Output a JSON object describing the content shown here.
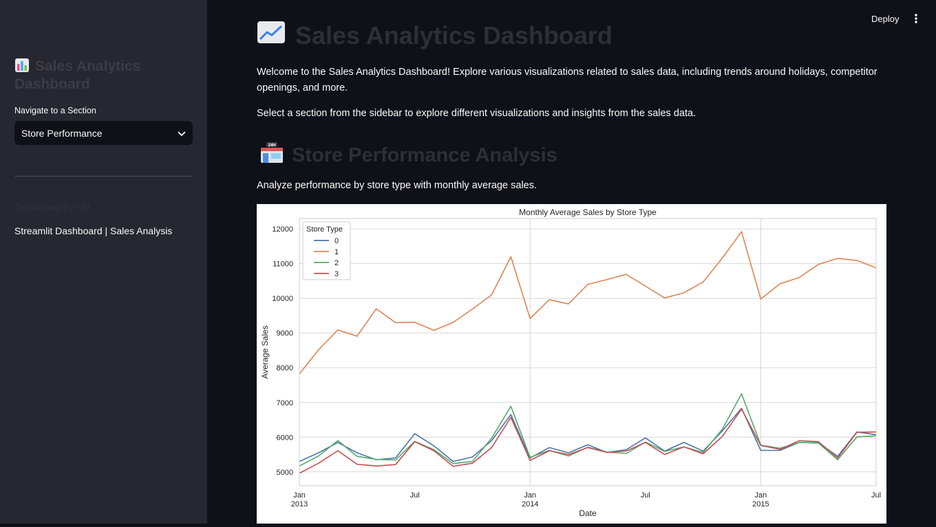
{
  "sidebar": {
    "title": "Sales Analytics Dashboard",
    "nav_label": "Navigate to a Section",
    "selected_section": "Store Performance",
    "developer_text": "Developed by KM",
    "footer_text": "Streamlit Dashboard | Sales Analysis"
  },
  "header": {
    "deploy_label": "Deploy"
  },
  "main": {
    "title": "Sales Analytics Dashboard",
    "welcome": "Welcome to the Sales Analytics Dashboard! Explore various visualizations related to sales data, including trends around holidays, competitor openings, and more.",
    "instruction": "Select a section from the sidebar to explore different visualizations and insights from the sales data.",
    "section_title": "Store Performance Analysis",
    "section_desc": "Analyze performance by store type with monthly average sales."
  },
  "chart_data": {
    "type": "line",
    "title": "Monthly Average Sales by Store Type",
    "xlabel": "Date",
    "ylabel": "Average Sales",
    "legend_title": "Store Type",
    "legend_position": "top-left",
    "grid": true,
    "ylim": [
      4600,
      12300
    ],
    "yticks": [
      5000,
      6000,
      7000,
      8000,
      9000,
      10000,
      11000,
      12000
    ],
    "xticks": [
      {
        "index": 0,
        "label": "Jan",
        "sub": "2013"
      },
      {
        "index": 6,
        "label": "Jul",
        "sub": ""
      },
      {
        "index": 12,
        "label": "Jan",
        "sub": "2014"
      },
      {
        "index": 18,
        "label": "Jul",
        "sub": ""
      },
      {
        "index": 24,
        "label": "Jan",
        "sub": "2015"
      },
      {
        "index": 30,
        "label": "Jul",
        "sub": ""
      }
    ],
    "major_grid_indices": [
      12,
      24
    ],
    "x": [
      "2013-01",
      "2013-02",
      "2013-03",
      "2013-04",
      "2013-05",
      "2013-06",
      "2013-07",
      "2013-08",
      "2013-09",
      "2013-10",
      "2013-11",
      "2013-12",
      "2014-01",
      "2014-02",
      "2014-03",
      "2014-04",
      "2014-05",
      "2014-06",
      "2014-07",
      "2014-08",
      "2014-09",
      "2014-10",
      "2014-11",
      "2014-12",
      "2015-01",
      "2015-02",
      "2015-03",
      "2015-04",
      "2015-05",
      "2015-06",
      "2015-07"
    ],
    "series": [
      {
        "name": "0",
        "color": "#4c72b0",
        "values": [
          5300,
          5550,
          5850,
          5550,
          5350,
          5400,
          6100,
          5750,
          5300,
          5430,
          5900,
          6650,
          5400,
          5700,
          5550,
          5780,
          5560,
          5640,
          5980,
          5600,
          5850,
          5600,
          6180,
          6830,
          5620,
          5620,
          5850,
          5840,
          5450,
          6150,
          6070
        ]
      },
      {
        "name": "1",
        "color": "#dd8452",
        "values": [
          7820,
          8520,
          9090,
          8910,
          9700,
          9300,
          9310,
          9080,
          9310,
          9690,
          10100,
          11200,
          9420,
          9960,
          9840,
          10400,
          10540,
          10690,
          10350,
          10010,
          10160,
          10470,
          11160,
          11920,
          9980,
          10420,
          10600,
          10980,
          11150,
          11090,
          10880
        ]
      },
      {
        "name": "2",
        "color": "#55a868",
        "values": [
          5170,
          5460,
          5900,
          5450,
          5360,
          5340,
          5880,
          5640,
          5240,
          5300,
          5970,
          6890,
          5420,
          5620,
          5460,
          5710,
          5570,
          5530,
          5860,
          5590,
          5720,
          5560,
          6230,
          7250,
          5770,
          5680,
          5850,
          5830,
          5350,
          6010,
          6040
        ]
      },
      {
        "name": "3",
        "color": "#c44e52",
        "values": [
          4960,
          5250,
          5610,
          5220,
          5170,
          5210,
          5870,
          5610,
          5160,
          5250,
          5700,
          6570,
          5330,
          5610,
          5500,
          5700,
          5560,
          5600,
          5850,
          5500,
          5720,
          5520,
          6020,
          6810,
          5760,
          5650,
          5900,
          5870,
          5400,
          6140,
          6150
        ]
      }
    ]
  }
}
